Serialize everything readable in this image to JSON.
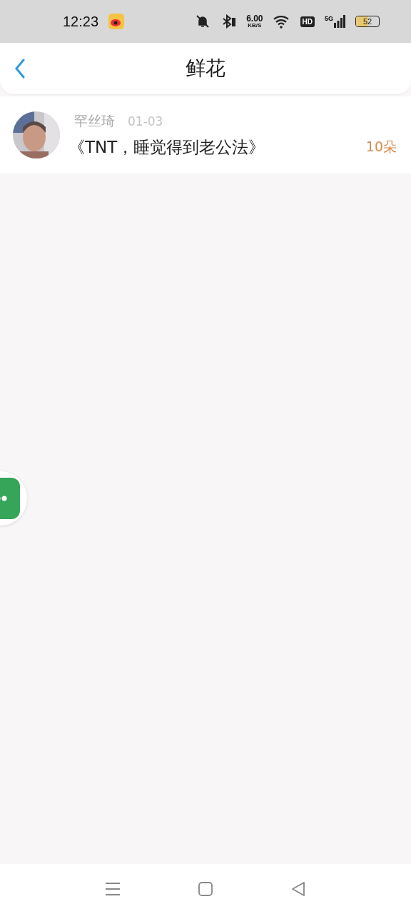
{
  "status_bar": {
    "time": "12:23",
    "speed": "6.00",
    "speed_unit": "KB/S",
    "hd": "HD",
    "network": "5G",
    "battery": "52"
  },
  "header": {
    "title": "鲜花"
  },
  "items": [
    {
      "name": "罕丝琦",
      "date": "01-03",
      "title": "《TNT，睡觉得到老公法》",
      "count": "10朵"
    }
  ]
}
